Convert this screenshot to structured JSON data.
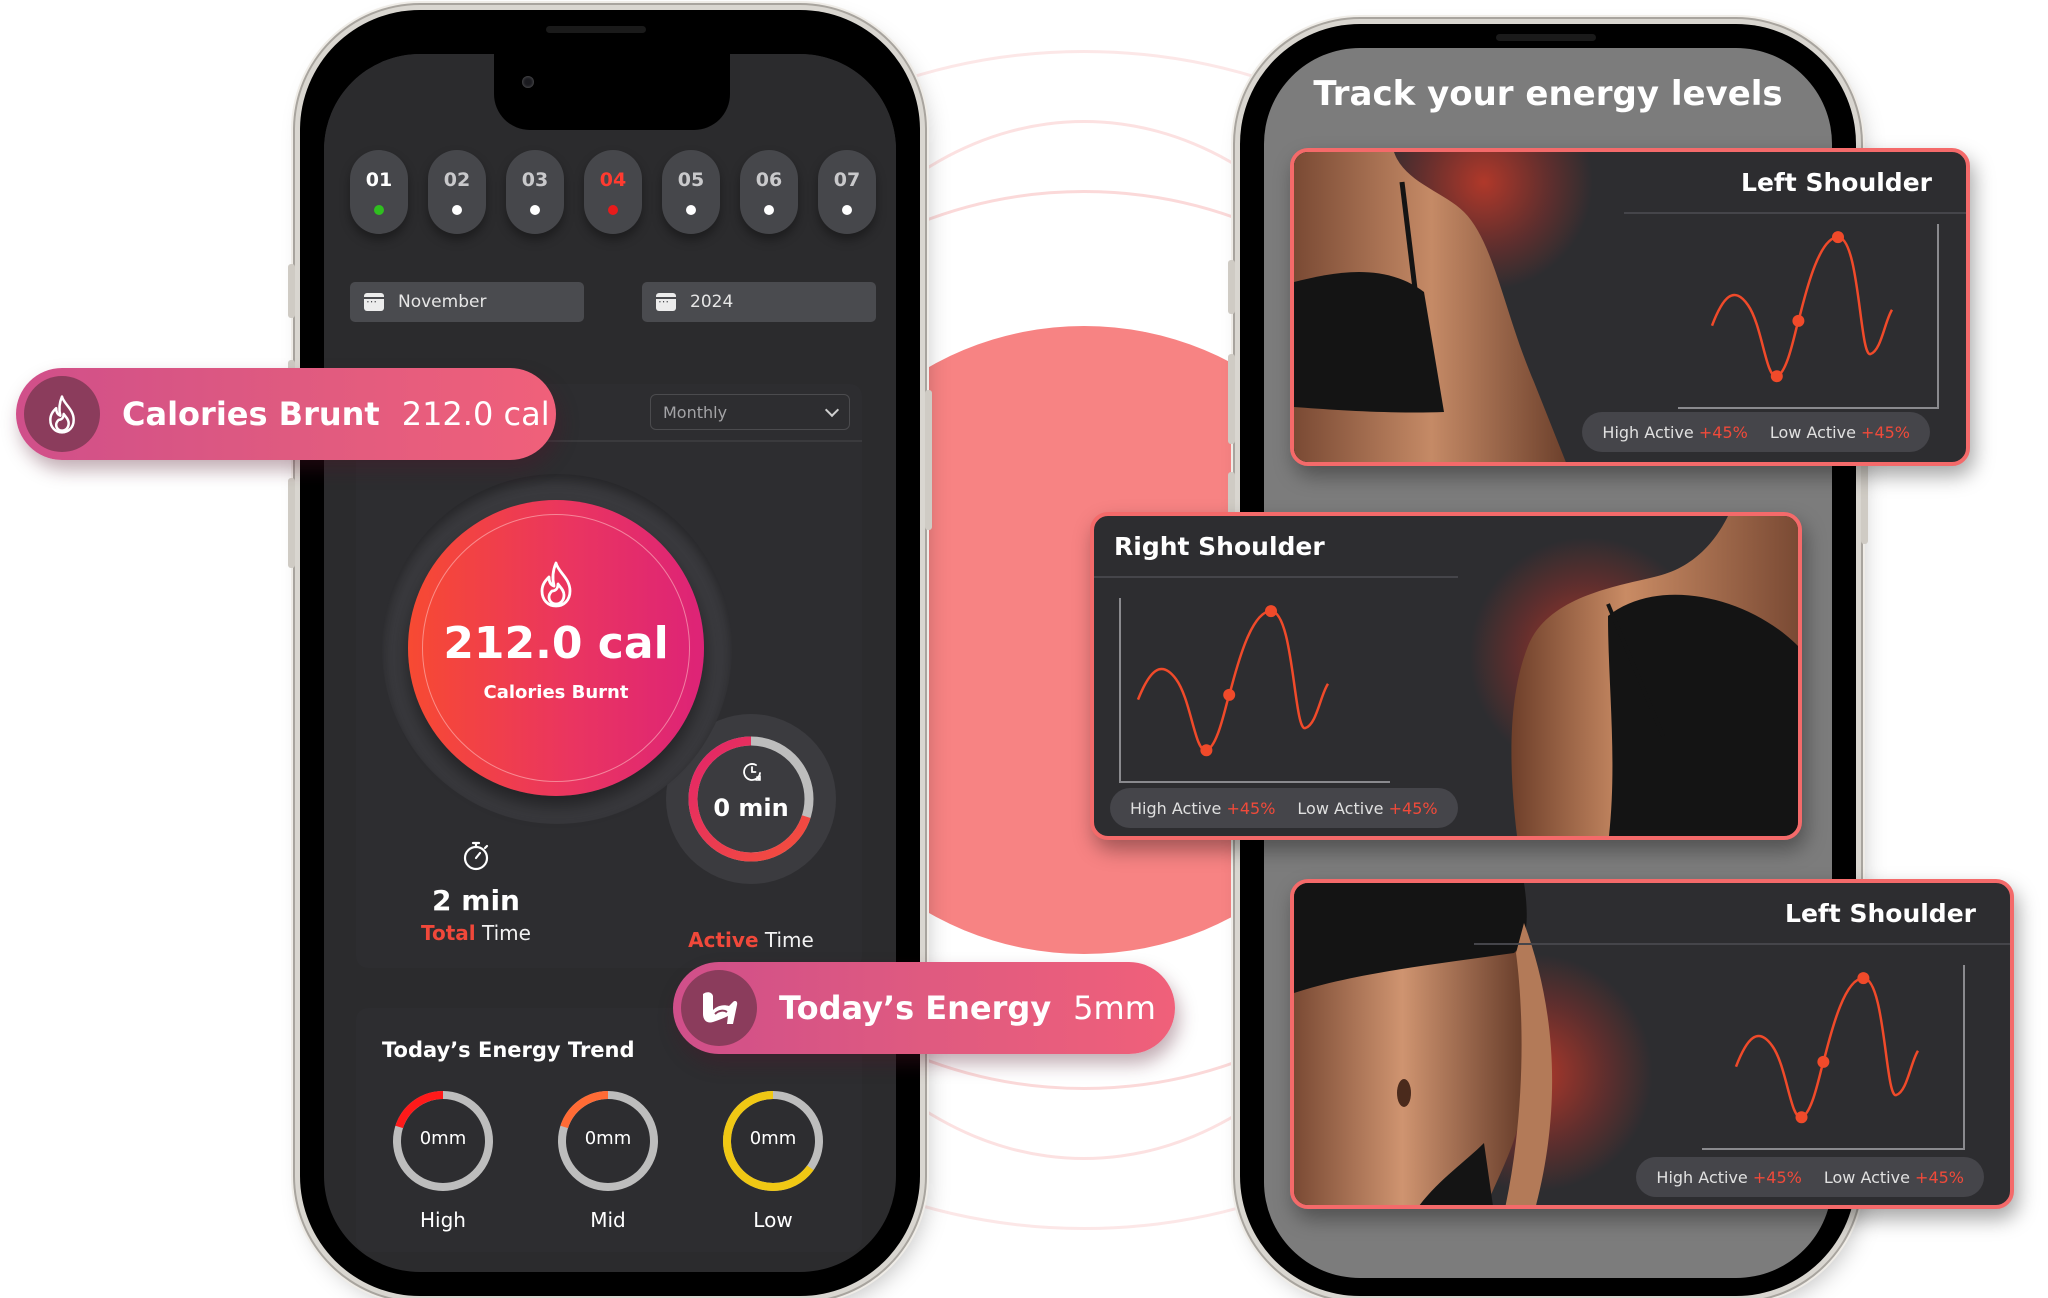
{
  "left_phone": {
    "days": [
      {
        "num": "01",
        "dot": "green"
      },
      {
        "num": "02",
        "dot": "white"
      },
      {
        "num": "03",
        "dot": "white"
      },
      {
        "num": "04",
        "dot": "red",
        "selected": true
      },
      {
        "num": "05",
        "dot": "white"
      },
      {
        "num": "06",
        "dot": "white"
      },
      {
        "num": "07",
        "dot": "white"
      }
    ],
    "month_select": {
      "value": "November",
      "icon": "calendar-icon"
    },
    "year_select": {
      "value": "2024",
      "icon": "calendar-icon"
    },
    "period_dropdown": {
      "value": "Monthly",
      "icon": "chevron-down-icon"
    },
    "calories": {
      "value": "212.0 cal",
      "label": "Calories Burnt",
      "icon": "flame-icon"
    },
    "active_time": {
      "value": "0 min",
      "label_accent": "Active",
      "label_rest": " Time",
      "icon": "clock-refresh-icon",
      "progress": 0.7
    },
    "total_time": {
      "value": "2 min",
      "label_accent": "Total",
      "label_rest": " Time",
      "icon": "stopwatch-icon"
    },
    "energy_trend": {
      "title": "Today’s Energy Trend",
      "rings": [
        {
          "label": "High",
          "value": "0mm",
          "progress": 0.2,
          "color": "#ff1a1a"
        },
        {
          "label": "Mid",
          "value": "0mm",
          "progress": 0.2,
          "color": "#ff6b35"
        },
        {
          "label": "Low",
          "value": "0mm",
          "progress": 0.65,
          "color": "#f0c814"
        }
      ]
    }
  },
  "pills": {
    "calories": {
      "label": "Calories Brunt",
      "value": "212.0 cal",
      "icon": "flame-icon"
    },
    "energy": {
      "label": "Today’s Energy",
      "value": "5mm",
      "icon": "flexed-arm-icon"
    }
  },
  "right_phone": {
    "title": "Track your energy levels",
    "cards": [
      {
        "title": "Left Shoulder",
        "high_label": "High Active",
        "high_value": "+45%",
        "low_label": "Low Active",
        "low_value": "+45%"
      },
      {
        "title": "Right Shoulder",
        "high_label": "High Active",
        "high_value": "+45%",
        "low_label": "Low Active",
        "low_value": "+45%"
      },
      {
        "title": "Left Shoulder",
        "high_label": "High Active",
        "high_value": "+45%",
        "low_label": "Low Active",
        "low_value": "+45%"
      }
    ]
  },
  "colors": {
    "accent": "#f0483a",
    "pill_gradient_start": "#d04f8a",
    "pill_gradient_end": "#f0607a",
    "card_border": "#f46a6a",
    "line": "#f04a2a"
  }
}
